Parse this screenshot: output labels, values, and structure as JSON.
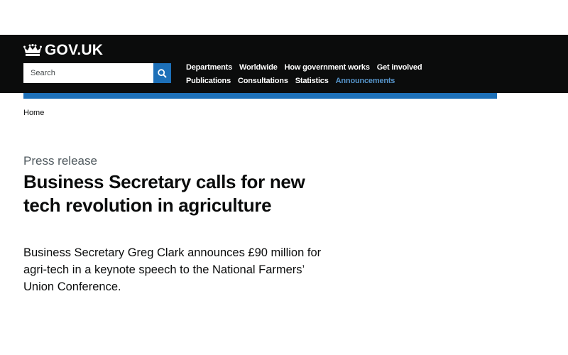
{
  "header": {
    "logo_text": "GOV.UK",
    "search": {
      "placeholder": "Search"
    },
    "nav": {
      "row1": [
        "Departments",
        "Worldwide",
        "How government works",
        "Get involved"
      ],
      "row2": [
        "Publications",
        "Consultations",
        "Statistics",
        "Announcements"
      ],
      "active": "Announcements"
    }
  },
  "colors": {
    "header_bg": "#0b0c0c",
    "accent_blue": "#1d70b8",
    "active_link": "#5694ca",
    "secondary_text": "#505a5f"
  },
  "breadcrumb": {
    "home": "Home"
  },
  "article": {
    "type": "Press release",
    "title": "Business Secretary calls for new tech revolution in agriculture",
    "lead": "Business Secretary Greg Clark announces £90 million for agri-tech in a keynote speech to the National Farmers’ Union Conference."
  }
}
